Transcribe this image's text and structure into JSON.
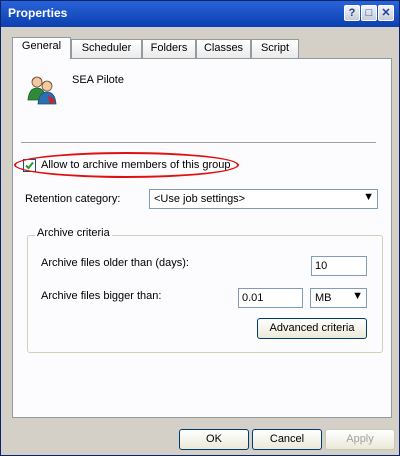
{
  "window": {
    "title": "Properties"
  },
  "titlebar_buttons": {
    "help": "?",
    "maximize": "□",
    "close": "✕"
  },
  "tabs": [
    {
      "label": "General",
      "active": true
    },
    {
      "label": "Scheduler",
      "active": false
    },
    {
      "label": "Folders",
      "active": false
    },
    {
      "label": "Classes",
      "active": false
    },
    {
      "label": "Script",
      "active": false
    }
  ],
  "general": {
    "group_icon": "group-users-icon",
    "group_name": "SEA Pilote",
    "archive_members_label": "Allow to archive members of this group",
    "archive_members_checked": true,
    "retention_label": "Retention category:",
    "retention_value": "<Use job settings>",
    "archive_criteria": {
      "legend": "Archive criteria",
      "older_than_label": "Archive files older than (days):",
      "older_than_value": "10",
      "bigger_than_label": "Archive files bigger than:",
      "bigger_than_value": "0.01",
      "size_unit": "MB",
      "advanced_button": "Advanced criteria"
    }
  },
  "footer": {
    "ok": "OK",
    "cancel": "Cancel",
    "apply": "Apply"
  },
  "colors": {
    "highlight_oval": "#e01010",
    "title_bar": "#0a3fb0"
  }
}
